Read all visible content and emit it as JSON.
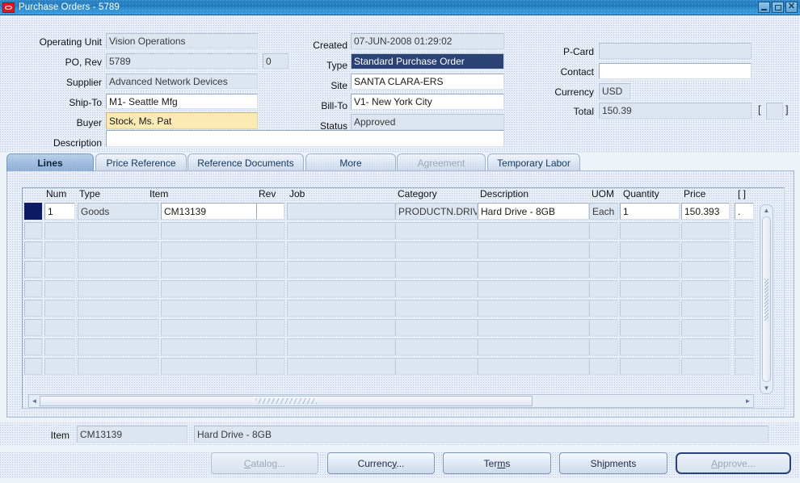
{
  "window": {
    "title": "Purchase Orders - 5789",
    "logo_icon": "oracle-logo-icon",
    "minimize_label": "",
    "maximize_label": "",
    "close_label": "✕"
  },
  "header": {
    "fields": [
      {
        "label": "Operating Unit",
        "value": "Vision Operations",
        "state": "readonly"
      },
      {
        "label": "PO, Rev",
        "value": "5789",
        "state": "readonly"
      },
      {
        "label": "",
        "value": "0",
        "state": "readonly"
      },
      {
        "label": "Supplier",
        "value": "Advanced Network Devices",
        "state": "readonly"
      },
      {
        "label": "Ship-To",
        "value": "M1- Seattle Mfg",
        "state": "editable"
      },
      {
        "label": "Buyer",
        "value": "Stock, Ms. Pat",
        "state": "current"
      },
      {
        "label": "Description",
        "value": "",
        "state": "editable"
      },
      {
        "label": "Created",
        "value": "07-JUN-2008 01:29:02",
        "state": "readonly"
      },
      {
        "label": "Type",
        "value": "Standard Purchase Order",
        "state": "selected"
      },
      {
        "label": "Site",
        "value": "SANTA CLARA-ERS",
        "state": "editable"
      },
      {
        "label": "Bill-To",
        "value": "V1- New York City",
        "state": "editable"
      },
      {
        "label": "Status",
        "value": "Approved",
        "state": "readonly"
      },
      {
        "label": "P-Card",
        "value": "",
        "state": "readonly"
      },
      {
        "label": "Contact",
        "value": "",
        "state": "editable"
      },
      {
        "label": "Currency",
        "value": "USD",
        "state": "readonly"
      },
      {
        "label": "Total",
        "value": "150.39",
        "state": "readonly"
      }
    ],
    "total_flex_open": "[",
    "total_flex_close": "]"
  },
  "tabs": [
    {
      "label": "Lines",
      "state": "active"
    },
    {
      "label": "Price Reference",
      "state": "enabled"
    },
    {
      "label": "Reference Documents",
      "state": "enabled"
    },
    {
      "label": "More",
      "state": "enabled"
    },
    {
      "label": "Agreement",
      "state": "disabled"
    },
    {
      "label": "Temporary Labor",
      "state": "enabled"
    }
  ],
  "lines_grid": {
    "columns": [
      "Num",
      "Type",
      "Item",
      "Rev",
      "Job",
      "Category",
      "Description",
      "UOM",
      "Quantity",
      "Price",
      "[  ]"
    ],
    "rows": [
      {
        "current": true,
        "cells": {
          "Num": "1",
          "Type": "Goods",
          "Item": "CM13139",
          "Rev": "",
          "Job": "",
          "Category": "PRODUCTN.DRIV",
          "Description": "Hard Drive - 8GB",
          "UOM": "Each",
          "Quantity": "1",
          "Price": "150.393",
          "[  ]": "."
        }
      }
    ],
    "empty_row_count": 8,
    "vertical_scrollbar": {
      "up_arrow": "▲",
      "down_arrow": "▼"
    },
    "horizontal_scrollbar": {
      "left_arrow": "◄",
      "right_arrow": "►"
    }
  },
  "bottom": {
    "item_label": "Item",
    "item_value": "CM13139",
    "item_description": "Hard Drive - 8GB"
  },
  "buttons": [
    {
      "label": "Catalog...",
      "mnemonic": "C",
      "state": "disabled"
    },
    {
      "label": "Currency...",
      "mnemonic": "y",
      "state": "enabled"
    },
    {
      "label": "Terms",
      "mnemonic": "m",
      "state": "enabled"
    },
    {
      "label": "Shipments",
      "mnemonic": "i",
      "state": "enabled"
    },
    {
      "label": "Approve...",
      "mnemonic": "A",
      "state": "disabled-focused"
    }
  ]
}
